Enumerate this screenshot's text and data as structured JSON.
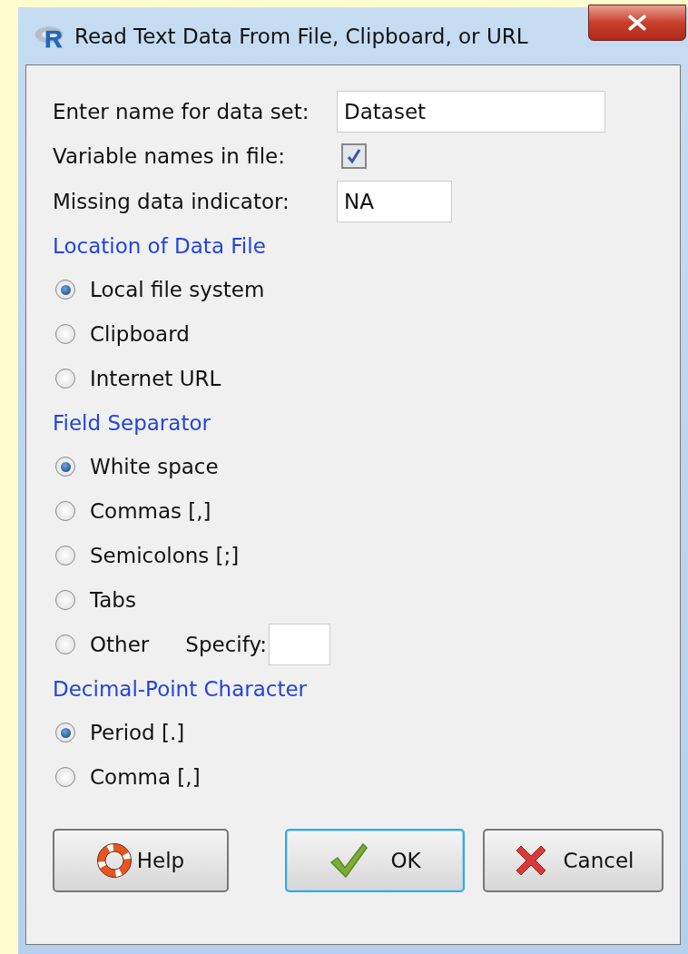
{
  "window": {
    "title": "Read Text Data From File, Clipboard, or URL"
  },
  "fields": [
    {
      "kind": "text",
      "label": "Enter name for data set:",
      "value": "Dataset"
    },
    {
      "kind": "checkbox",
      "label": "Variable names in file:",
      "checked": true
    },
    {
      "kind": "text",
      "label": "Missing data indicator:",
      "value": "NA"
    }
  ],
  "sections": [
    {
      "title": "Location of Data File",
      "options": [
        {
          "label": "Local file system",
          "selected": true
        },
        {
          "label": "Clipboard",
          "selected": false
        },
        {
          "label": "Internet URL",
          "selected": false
        }
      ]
    },
    {
      "title": "Field Separator",
      "options": [
        {
          "label": "White space",
          "selected": true
        },
        {
          "label": "Commas [,]",
          "selected": false
        },
        {
          "label": "Semicolons [;]",
          "selected": false
        },
        {
          "label": "Tabs",
          "selected": false
        },
        {
          "label": "Other",
          "selected": false,
          "specify_label": "Specify:"
        }
      ]
    },
    {
      "title": "Decimal-Point Character",
      "options": [
        {
          "label": "Period [.]",
          "selected": true
        },
        {
          "label": "Comma [,]",
          "selected": false
        }
      ]
    }
  ],
  "buttons": [
    {
      "kind": "help",
      "label": "Help",
      "focused": false
    },
    {
      "kind": "ok",
      "label": "OK",
      "focused": true
    },
    {
      "kind": "cancel",
      "label": "Cancel",
      "focused": false
    }
  ]
}
